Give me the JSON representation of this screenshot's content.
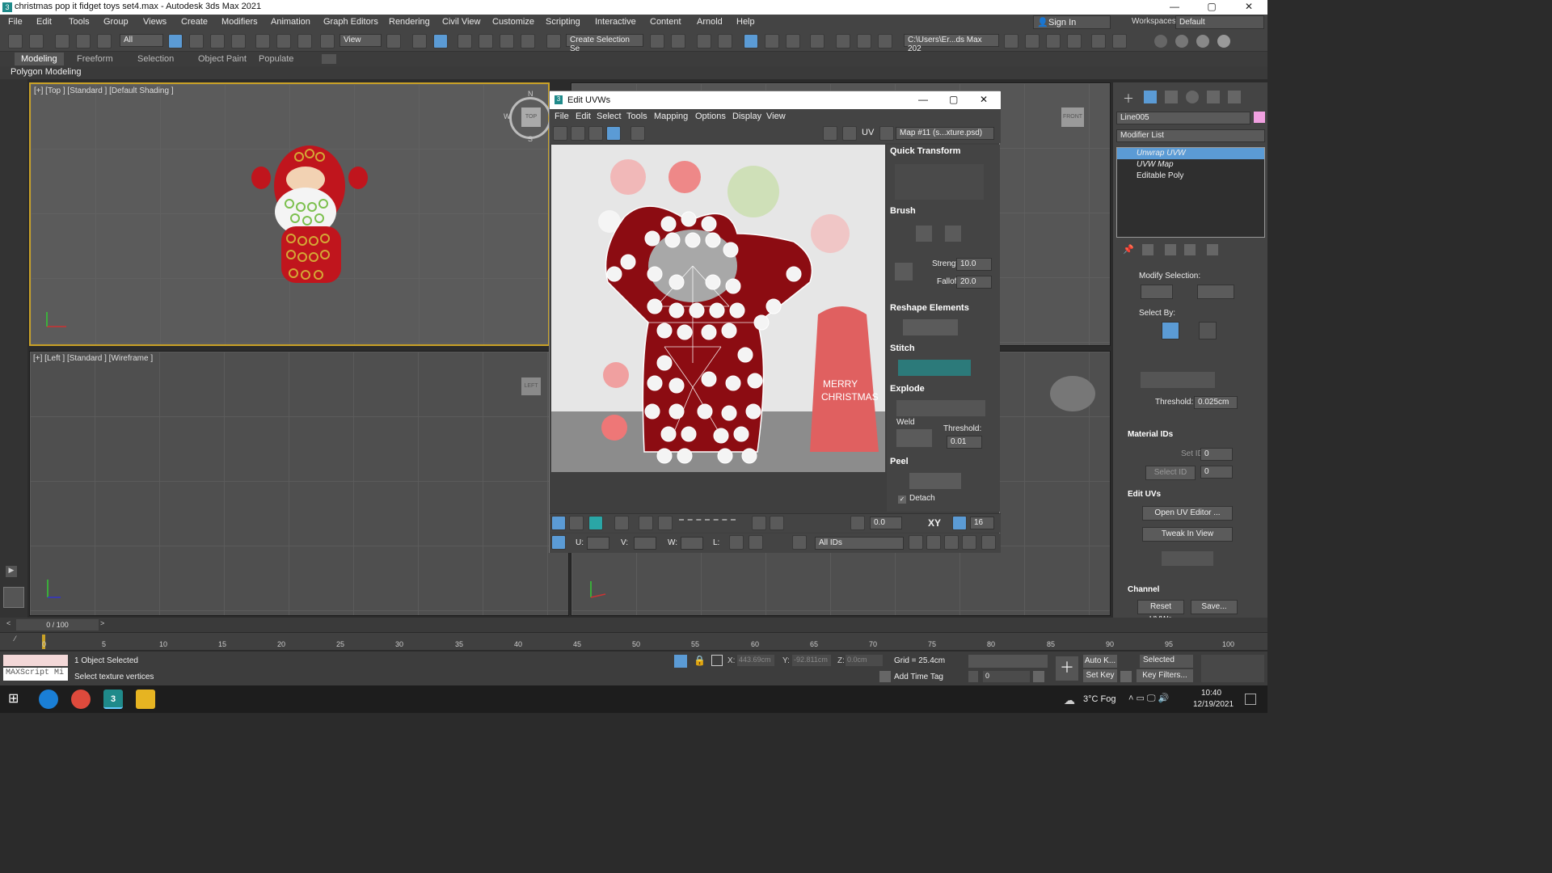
{
  "app": {
    "title": "christmas pop it fidget toys set4.max - Autodesk 3ds Max 2021",
    "window_controls": [
      "—",
      "▢",
      "✕"
    ]
  },
  "menu": [
    "File",
    "Edit",
    "Tools",
    "Group",
    "Views",
    "Create",
    "Modifiers",
    "Animation",
    "Graph Editors",
    "Rendering",
    "Civil View",
    "Customize",
    "Scripting",
    "Interactive",
    "Content",
    "Arnold",
    "Help"
  ],
  "account": {
    "sign_in": "Sign In",
    "workspaces_label": "Workspaces:",
    "workspace_value": "Default"
  },
  "toolbar": {
    "filter_value": "All",
    "ref_coord": "View",
    "selection_set": "Create Selection Se",
    "project_path": "C:\\Users\\Er...ds Max 202"
  },
  "ribbon": {
    "tabs": [
      "Modeling",
      "Freeform",
      "Selection",
      "Object Paint",
      "Populate"
    ],
    "active": "Modeling",
    "sub": "Polygon Modeling"
  },
  "viewports": {
    "top_label": "[+] [Top ] [Standard ] [Default Shading ]",
    "left_label": "[+] [Left ] [Standard ] [Wireframe ]",
    "viewcube_top": "TOP",
    "viewcube_left": "LEFT",
    "viewcube_front": "FRONT",
    "compass": [
      "N",
      "W",
      "S"
    ]
  },
  "uvw": {
    "title": "Edit UVWs",
    "menu": [
      "File",
      "Edit",
      "Select",
      "Tools",
      "Mapping",
      "Options",
      "Display",
      "View"
    ],
    "uv_label": "UV",
    "map_dropdown": "Map #11 (s...xture.psd)",
    "sections": {
      "quick_transform": "Quick Transform",
      "brush": "Brush",
      "strength_label": "Strength:",
      "strength_value": "10.0",
      "falloff_label": "Falloff:",
      "falloff_value": "20.0",
      "reshape": "Reshape Elements",
      "stitch": "Stitch",
      "explode": "Explode",
      "weld": "Weld",
      "threshold_label": "Threshold:",
      "threshold_value": "0.01",
      "peel": "Peel",
      "detach": "Detach"
    },
    "bottom": {
      "angle_value": "0.0",
      "xy": "XY",
      "grid_value": "16",
      "u_label": "U:",
      "v_label": "V:",
      "w_label": "W:",
      "l_label": "L:",
      "ids_dropdown": "All IDs"
    },
    "texture_text": "MERRY CHRISTMAS"
  },
  "command_panel": {
    "object_name": "Line005",
    "modifier_list": "Modifier List",
    "stack": [
      {
        "label": "Unwrap UVW",
        "selected": true,
        "italic": true
      },
      {
        "label": "UVW Map",
        "selected": false,
        "italic": true
      },
      {
        "label": "Editable Poly",
        "selected": false,
        "italic": false
      }
    ],
    "modify_selection": "Modify Selection:",
    "select_by": "Select By:",
    "threshold_label": "Threshold:",
    "threshold_value": "0.025cm",
    "material_ids": "Material IDs",
    "set_id": "Set ID:",
    "set_id_value": "0",
    "select_id": "Select ID",
    "select_id_value": "0",
    "edit_uvs": "Edit UVs",
    "open_uv_editor": "Open UV Editor ...",
    "tweak_in_view": "Tweak In View",
    "channel": "Channel",
    "reset_uvws": "Reset UVWs",
    "save": "Save..."
  },
  "timeline": {
    "frame_display": "0 / 100",
    "ticks": [
      "0",
      "5",
      "10",
      "15",
      "20",
      "25",
      "30",
      "35",
      "40",
      "45",
      "50",
      "55",
      "60",
      "65",
      "70",
      "75",
      "80",
      "85",
      "90",
      "95",
      "100"
    ]
  },
  "status": {
    "maxscript": "MAXScript Mi",
    "objects_selected": "1 Object Selected",
    "prompt": "Select texture vertices",
    "x_label": "X:",
    "x_value": "443.69cm",
    "y_label": "Y:",
    "y_value": "-92.811cm",
    "z_label": "Z:",
    "z_value": "0.0cm",
    "grid": "Grid = 25.4cm",
    "add_time_tag": "Add Time Tag",
    "auto_key": "Auto K...",
    "set_key": "Set Key",
    "selected_dd": "Selected",
    "key_filters": "Key Filters...",
    "frame_value": "0"
  },
  "taskbar": {
    "weather": "3°C  Fog",
    "time": "10:40",
    "date": "12/19/2021"
  },
  "colors": {
    "accent_blue": "#5b9bd5",
    "santa_red": "#c0151d",
    "viewport_active": "#c9a227"
  }
}
